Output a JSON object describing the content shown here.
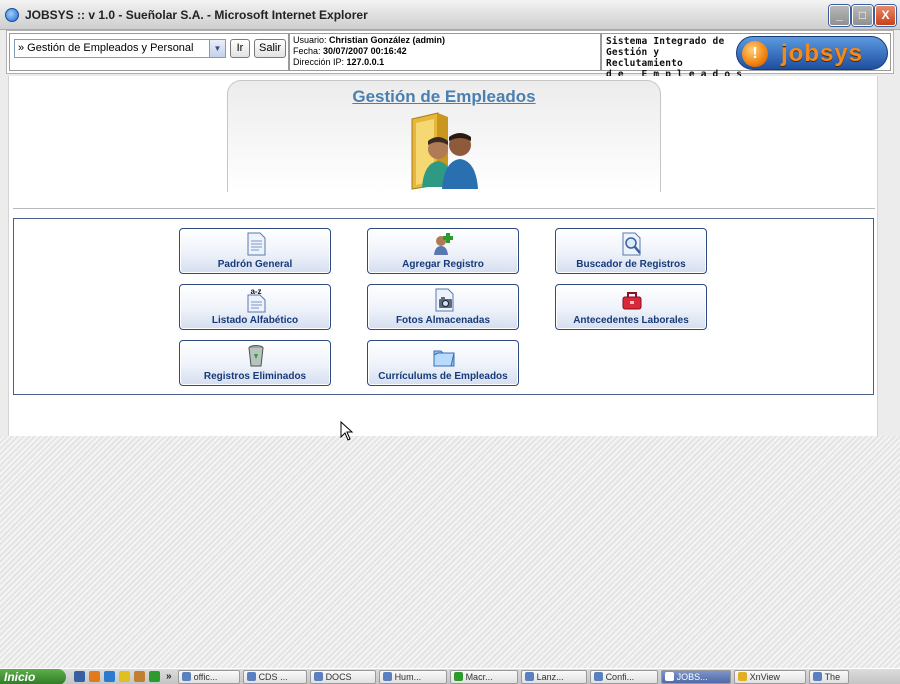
{
  "window": {
    "title": "JOBSYS :: v 1.0 - Sueñolar S.A. - Microsoft Internet Explorer",
    "buttons": {
      "minimize": "_",
      "maximize": "□",
      "close": "X"
    }
  },
  "header": {
    "module_select": "» Gestión de Empleados y Personal",
    "go_button": "Ir",
    "exit_button": "Salir",
    "user_label": "Usuario:",
    "user_value": "Christian González (admin)",
    "date_label": "Fecha:",
    "date_value": "30/07/2007 00:16:42",
    "ip_label": "Dirección IP:",
    "ip_value": "127.0.0.1",
    "brand_line1": "Sistema Integrado de",
    "brand_line2": "Gestión y Reclutamiento",
    "brand_line3": "d e   E m p l e a d o s",
    "logo_text": "jobsys",
    "logo_orb": "!"
  },
  "hero": {
    "title": "Gestión de Empleados",
    "icon": "employees-folder-icon"
  },
  "tiles": [
    {
      "label": "Padrón General",
      "icon": "document-icon"
    },
    {
      "label": "Agregar Registro",
      "icon": "add-user-icon"
    },
    {
      "label": "Buscador de Registros",
      "icon": "search-document-icon"
    },
    {
      "label": "Listado Alfabético",
      "icon": "alphabetical-list-icon"
    },
    {
      "label": "Fotos Almacenadas",
      "icon": "photos-icon"
    },
    {
      "label": "Antecedentes Laborales",
      "icon": "toolbox-icon"
    },
    {
      "label": "Registros Eliminados",
      "icon": "recycle-bin-icon"
    },
    {
      "label": "Currículums de Empleados",
      "icon": "folder-icon"
    }
  ],
  "taskbar": {
    "start": "Inicio",
    "chevron": "»",
    "items": [
      {
        "label": "offic..."
      },
      {
        "label": "CDS ..."
      },
      {
        "label": "DOCS"
      },
      {
        "label": "Hum..."
      },
      {
        "label": "Macr..."
      },
      {
        "label": "Lanz..."
      },
      {
        "label": "Confi..."
      },
      {
        "label": "JOBS..."
      },
      {
        "label": "XnView"
      },
      {
        "label": "The"
      }
    ]
  },
  "colors": {
    "accent": "#4a7fb0",
    "tile_text": "#173a78",
    "logo_orange": "#f58a1a"
  }
}
